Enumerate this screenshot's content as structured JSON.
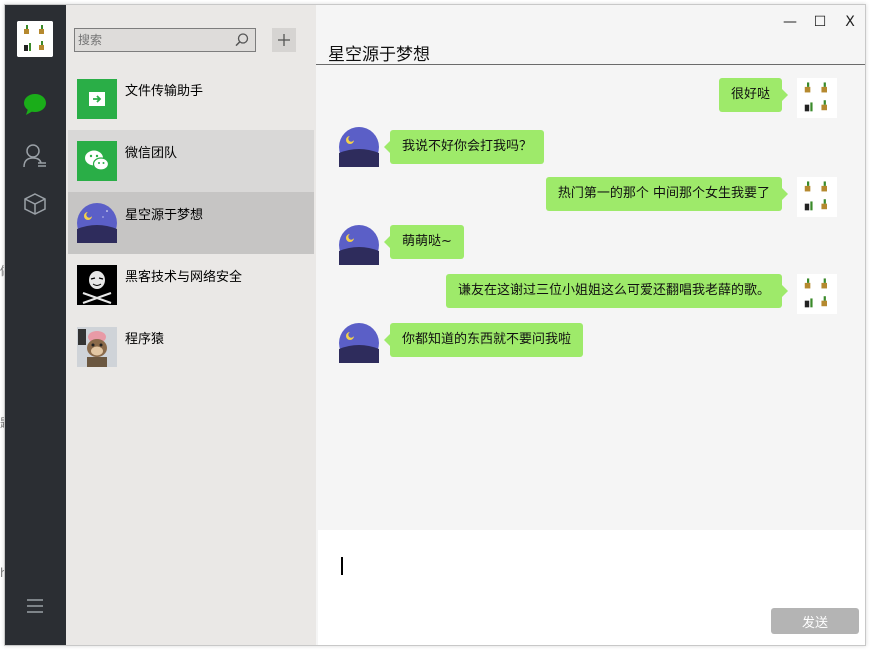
{
  "search": {
    "placeholder": "搜索"
  },
  "nav": {
    "chat_icon": "chat-bubble-icon",
    "contacts_icon": "contacts-icon",
    "favorites_icon": "cube-icon",
    "menu_icon": "menu-icon"
  },
  "contacts": [
    {
      "name": "文件传输助手",
      "avatar": "file-transfer-icon"
    },
    {
      "name": "微信团队",
      "avatar": "wechat-icon"
    },
    {
      "name": "星空源于梦想",
      "avatar": "night-sky-avatar"
    },
    {
      "name": "黑客技术与网络安全",
      "avatar": "hacker-mask-avatar"
    },
    {
      "name": "程序猿",
      "avatar": "monkey-avatar"
    }
  ],
  "chat": {
    "title": "星空源于梦想",
    "window_controls": {
      "minimize": "—",
      "maximize": "☐",
      "close": "X"
    },
    "messages": [
      {
        "side": "right",
        "text": "很好哒"
      },
      {
        "side": "left",
        "text": "我说不好你会打我吗？"
      },
      {
        "side": "right",
        "text": "热门第一的那个 中间那个女生我要了"
      },
      {
        "side": "left",
        "text": "萌萌哒~"
      },
      {
        "side": "right",
        "text": "谦友在这谢过三位小姐姐这么可爱还翻唱我老薛的歌。"
      },
      {
        "side": "left",
        "text": "你都知道的东西就不要问我啦"
      }
    ],
    "send_label": "发送"
  },
  "colors": {
    "sidebar": "#2b2e33",
    "contacts_bg": "#eae8e6",
    "selected": "#c6c5c4",
    "hover": "#d9d8d7",
    "bubble": "#9eea6a",
    "accent": "#1aad19"
  }
}
